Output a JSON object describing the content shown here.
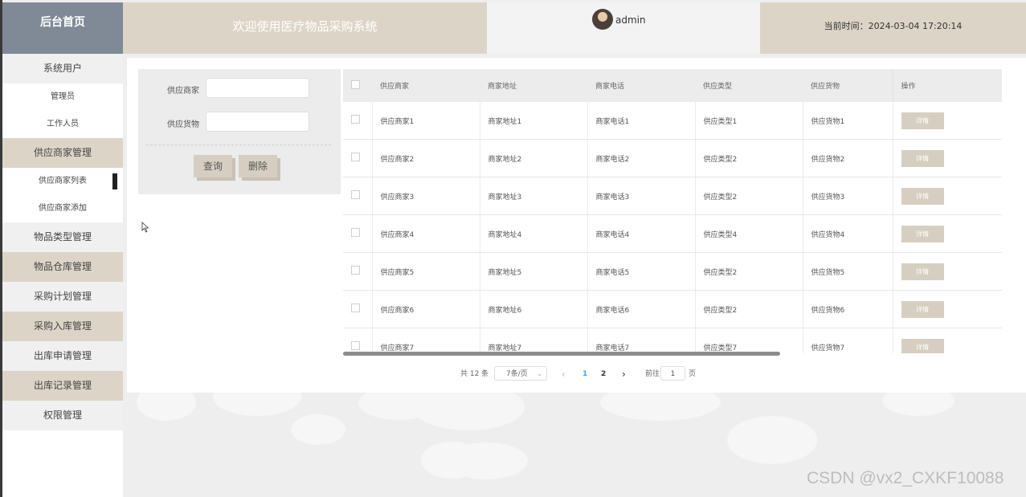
{
  "header": {
    "brand": "后台首页",
    "welcome": "欢迎使用医疗物品采购系统",
    "username": "admin",
    "time_text": "当前时间：2024-03-04 17:20:14"
  },
  "sidebar": {
    "items": [
      {
        "label": "系统用户"
      },
      {
        "label": "管理员"
      },
      {
        "label": "工作人员"
      },
      {
        "label": "供应商家管理"
      },
      {
        "label": "供应商家列表"
      },
      {
        "label": "供应商家添加"
      },
      {
        "label": "物品类型管理"
      },
      {
        "label": "物品仓库管理"
      },
      {
        "label": "采购计划管理"
      },
      {
        "label": "采购入库管理"
      },
      {
        "label": "出库申请管理"
      },
      {
        "label": "出库记录管理"
      },
      {
        "label": "权限管理"
      }
    ]
  },
  "search": {
    "supplier_label": "供应商家",
    "supplier_value": "",
    "goods_label": "供应货物",
    "goods_value": "",
    "query_button": "查询",
    "delete_button": "删除"
  },
  "table": {
    "headers": [
      "供应商家",
      "商家地址",
      "商家电话",
      "供应类型",
      "供应货物",
      "操作"
    ],
    "detail_label": "详情",
    "rows": [
      [
        "供应商家1",
        "商家地址1",
        "商家电话1",
        "供应类型1",
        "供应货物1"
      ],
      [
        "供应商家2",
        "商家地址2",
        "商家电话2",
        "供应类型2",
        "供应货物2"
      ],
      [
        "供应商家3",
        "商家地址3",
        "商家电话3",
        "供应类型2",
        "供应货物3"
      ],
      [
        "供应商家4",
        "商家地址4",
        "商家电话4",
        "供应类型4",
        "供应货物4"
      ],
      [
        "供应商家5",
        "商家地址5",
        "商家电话5",
        "供应类型2",
        "供应货物5"
      ],
      [
        "供应商家6",
        "商家地址6",
        "商家电话6",
        "供应类型2",
        "供应货物6"
      ],
      [
        "供应商家7",
        "商家地址7",
        "商家电话7",
        "供应类型7",
        "供应货物7"
      ]
    ]
  },
  "pagination": {
    "total_text": "共 12 条",
    "page_size": "7条/页",
    "prev_icon": "‹",
    "pages": [
      "1",
      "2"
    ],
    "current_page": "1",
    "next_icon": "›",
    "goto_label": "前往",
    "goto_value": "1",
    "page_suffix": "页"
  },
  "watermark": "CSDN @vx2_CXKF10088",
  "colors": {
    "accent": "#dcd5c7",
    "brand_bg": "#7f8a96",
    "active_page": "#409eff"
  }
}
